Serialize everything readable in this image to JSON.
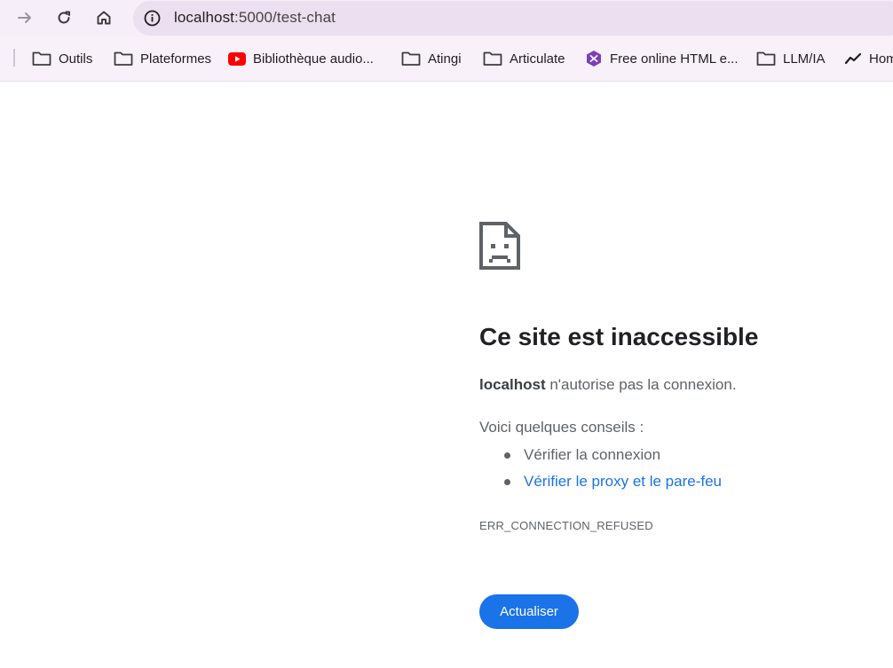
{
  "browser": {
    "url_host": "localhost",
    "url_rest": ":5000/test-chat",
    "bookmarks": [
      {
        "label": "Outils",
        "icon": "folder-icon"
      },
      {
        "label": "Plateformes",
        "icon": "folder-icon"
      },
      {
        "label": "Bibliothèque audio...",
        "icon": "youtube-icon"
      },
      {
        "label": "Atingi",
        "icon": "folder-icon"
      },
      {
        "label": "Articulate",
        "icon": "folder-icon"
      },
      {
        "label": "Free online HTML e...",
        "icon": "hexagon-logo-icon"
      },
      {
        "label": "LLM/IA",
        "icon": "folder-icon"
      },
      {
        "label": "Hom",
        "icon": "trend-icon"
      }
    ],
    "colors": {
      "toolbar_bg": "#f6eef8",
      "omnibox_bg": "#ecdff0",
      "youtube_red": "#ff0000",
      "hexagon_purple": "#7b3fb8"
    }
  },
  "error": {
    "icon": "sad-page-icon",
    "title": "Ce site est inaccessible",
    "host": "localhost",
    "message": " n'autorise pas la connexion.",
    "tips_heading": "Voici quelques conseils :",
    "tips": [
      {
        "label": "Vérifier la connexion",
        "is_link": false
      },
      {
        "label": "Vérifier le proxy et le pare-feu",
        "is_link": true
      }
    ],
    "code": "ERR_CONNECTION_REFUSED",
    "reload_label": "Actualiser",
    "accent": "#1a73e8"
  }
}
